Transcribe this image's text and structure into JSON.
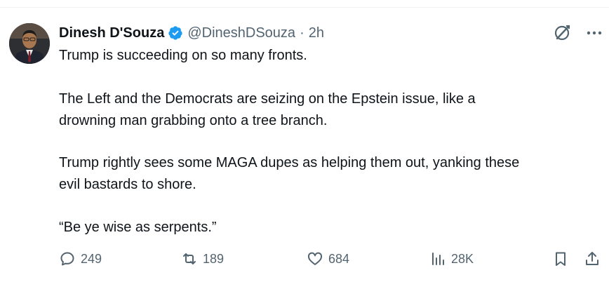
{
  "tweet": {
    "author_name": "Dinesh D'Souza",
    "handle": "@DineshDSouza",
    "separator": "·",
    "time": "2h",
    "verified_color": "#1d9bf0",
    "paragraphs": [
      "Trump is succeeding on so many fronts.",
      "The Left and the Democrats are seizing on the Epstein issue, like a\ndrowning man grabbing onto a tree branch.",
      "Trump rightly sees some MAGA dupes as helping them out, yanking these\nevil bastards to shore.",
      "“Be ye wise as serpents.”"
    ]
  },
  "actions": {
    "replies": "249",
    "reposts": "189",
    "likes": "684",
    "views": "28K"
  },
  "icons": {
    "reply": "speech-bubble-icon",
    "repost": "repost-arrows-icon",
    "like": "heart-icon",
    "views": "bar-chart-icon",
    "bookmark": "bookmark-icon",
    "share": "share-upload-icon",
    "grok": "grok-icon",
    "more": "more-dots-icon"
  }
}
